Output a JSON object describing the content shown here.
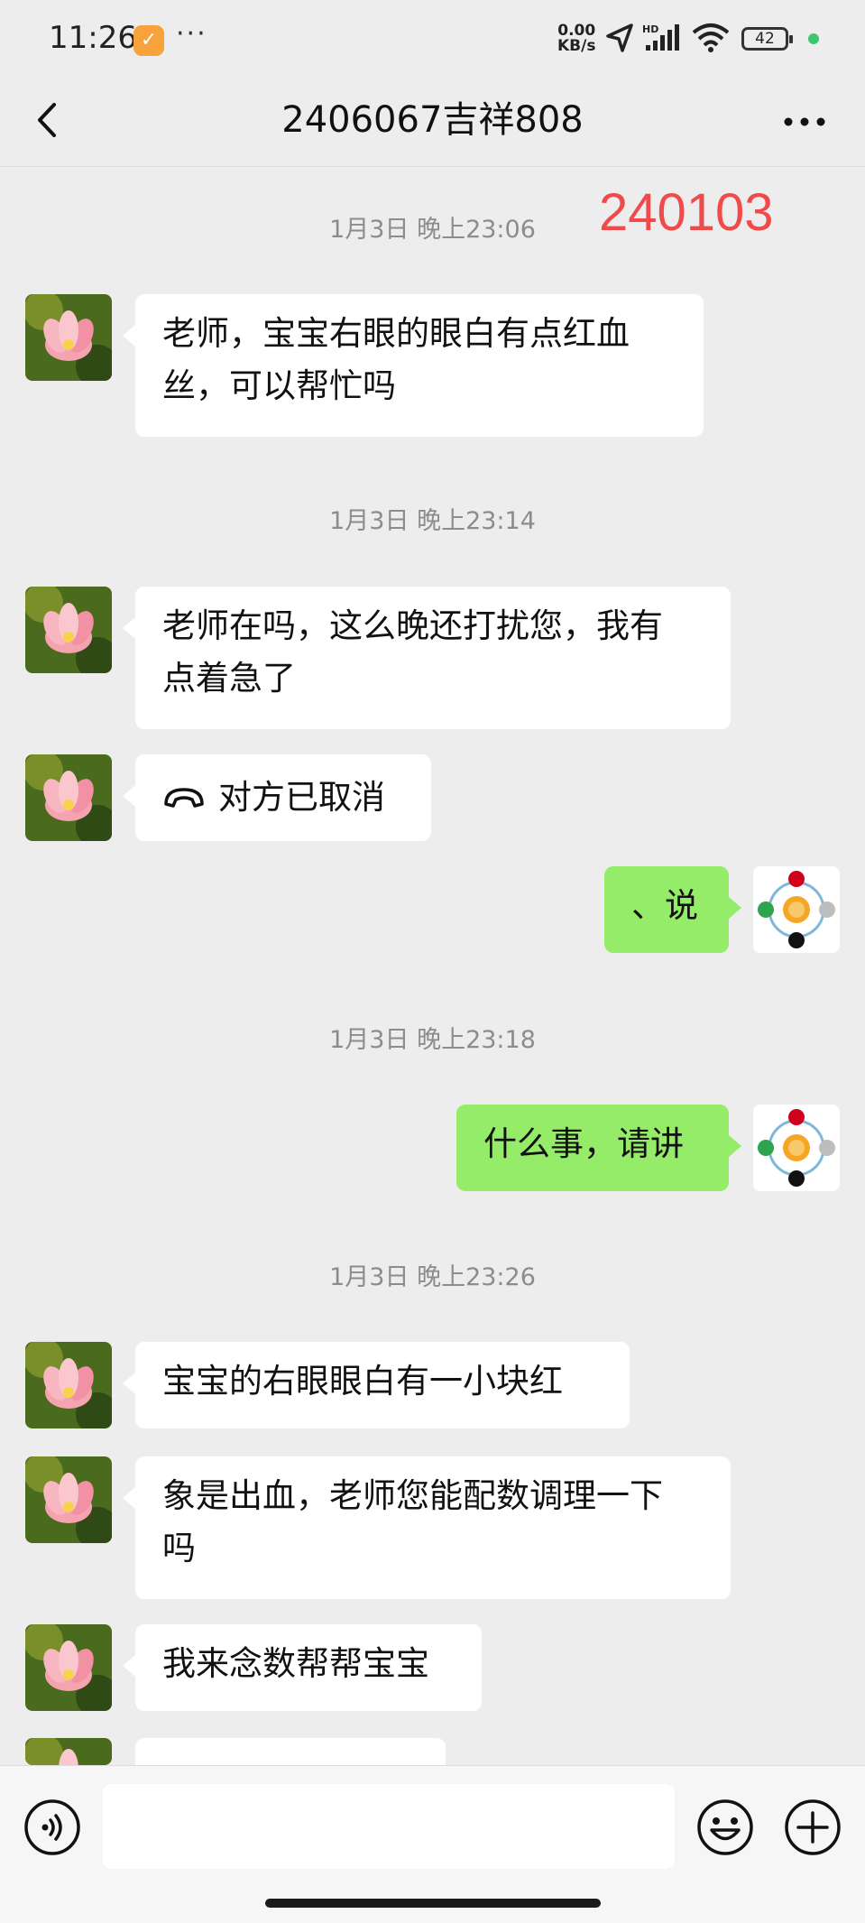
{
  "status_bar": {
    "time": "11:26",
    "more_dots": "···",
    "net_speed_value": "0.00",
    "net_speed_unit": "KB/s",
    "signal_label": "HD",
    "battery": "42"
  },
  "header": {
    "title": "2406067吉祥808"
  },
  "annotation_label": "240103",
  "colors": {
    "background": "#ededed",
    "incoming_bubble": "#ffffff",
    "outgoing_bubble": "#95ec69",
    "annotation": "#f04a4a",
    "timestamp": "#8c8c8c"
  },
  "messages": {
    "ts1": "1月3日 晚上23:06",
    "m1_line1": "老师，宝宝右眼的眼白有点红血",
    "m1_line2": "丝，可以帮忙吗",
    "ts2": "1月3日 晚上23:14",
    "m2_line1": "老师在吗，这么晚还打扰您，我有",
    "m2_line2": "点着急了",
    "m3_call": "对方已取消",
    "m4_out": "、说",
    "ts3": "1月3日 晚上23:18",
    "m5_out": "什么事，请讲",
    "ts4": "1月3日 晚上23:26",
    "m6": "宝宝的右眼眼白有一小块红",
    "m7_line1": "象是出血，老师您能配数调理一下",
    "m7_line2": "吗",
    "m8": "我来念数帮帮宝宝"
  },
  "icons": {
    "back": "chevron-left-icon",
    "more": "more-dots-icon",
    "voice": "voice-input-icon",
    "emoji": "emoji-icon",
    "add": "plus-icon",
    "call": "phone-hangup-icon"
  },
  "input": {
    "value": ""
  }
}
